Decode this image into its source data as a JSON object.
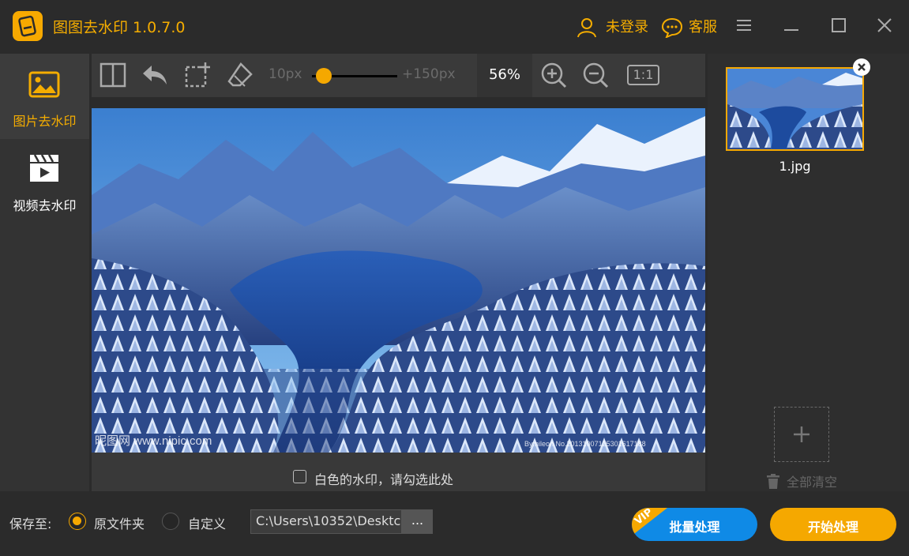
{
  "app": {
    "title": "图图去水印 1.0.7.0",
    "login_label": "未登录",
    "service_label": "客服"
  },
  "nav": {
    "items": [
      {
        "label": "图片去水印",
        "active": true
      },
      {
        "label": "视频去水印",
        "active": false
      }
    ]
  },
  "toolbar": {
    "brush_min": "10px",
    "brush_max": "+150px",
    "brush_value_fraction": 0.1,
    "zoom": "56%",
    "actual_size_label": "1:1"
  },
  "canvas": {
    "watermark_left": "昵图网 www.nipic.com",
    "watermark_right": "By:nileon No.20131007125301617188",
    "white_watermark_label": "白色的水印，请勾选此处"
  },
  "files": {
    "items": [
      {
        "name": "1.jpg"
      }
    ],
    "clear_all_label": "全部清空"
  },
  "footer": {
    "save_to_label": "保存至:",
    "option_original": "原文件夹",
    "option_custom": "自定义",
    "selected": "原文件夹",
    "path_value": "C:\\Users\\10352\\Desktc",
    "browse_label": "...",
    "vip_badge": "VIP",
    "batch_label": "批量处理",
    "start_label": "开始处理"
  },
  "colors": {
    "accent": "#f5a800",
    "blue_button": "#0f8ae6",
    "background": "#2b2b2b"
  }
}
